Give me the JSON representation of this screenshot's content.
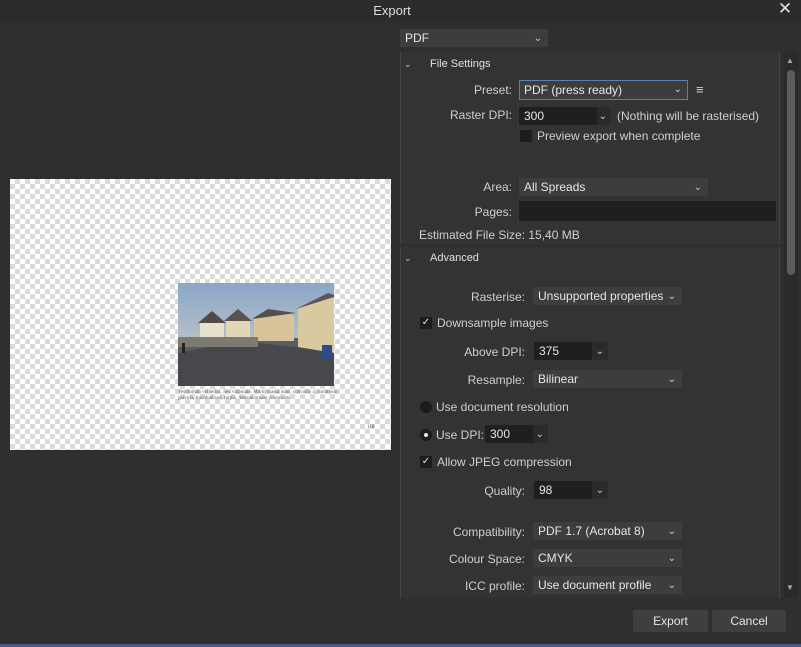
{
  "window": {
    "title": "Export"
  },
  "format": {
    "selected": "PDF"
  },
  "file_settings": {
    "header": "File Settings",
    "preset_label": "Preset:",
    "preset_value": "PDF (press ready)",
    "raster_dpi_label": "Raster DPI:",
    "raster_dpi_value": "300",
    "raster_note": "(Nothing will be rasterised)",
    "preview_export_label": "Preview export when complete",
    "preview_export_checked": false,
    "area_label": "Area:",
    "area_value": "All Spreads",
    "pages_label": "Pages:",
    "pages_value": "",
    "estimated_size": "Estimated File Size: 15,40 MB"
  },
  "advanced": {
    "header": "Advanced",
    "rasterise_label": "Rasterise:",
    "rasterise_value": "Unsupported properties",
    "downsample_label": "Downsample images",
    "downsample_checked": true,
    "above_dpi_label": "Above DPI:",
    "above_dpi_value": "375",
    "resample_label": "Resample:",
    "resample_value": "Bilinear",
    "use_doc_res_label": "Use document resolution",
    "use_dpi_label": "Use DPI:",
    "use_dpi_value": "300",
    "allow_jpeg_label": "Allow JPEG compression",
    "allow_jpeg_checked": true,
    "quality_label": "Quality:",
    "quality_value": "98",
    "compatibility_label": "Compatibility:",
    "compatibility_value": "PDF 1.7 (Acrobat 8)",
    "colour_space_label": "Colour Space:",
    "colour_space_value": "CMYK",
    "icc_label": "ICC profile:",
    "icc_value": "Use document profile"
  },
  "preview": {
    "caption": "Vestibulum vel tellus. Sed vulputate. Morbi massa nunc, convallis a, commodo gravida, tincidunt sed, turpis. Aenean ornare viverra est.",
    "page_number": "118"
  },
  "buttons": {
    "export": "Export",
    "cancel": "Cancel"
  },
  "colors": {
    "background": "#2f2f2f",
    "field": "#1f1f1f",
    "dropdown": "#3d3d3d",
    "accent_border": "#5a7fb0"
  }
}
